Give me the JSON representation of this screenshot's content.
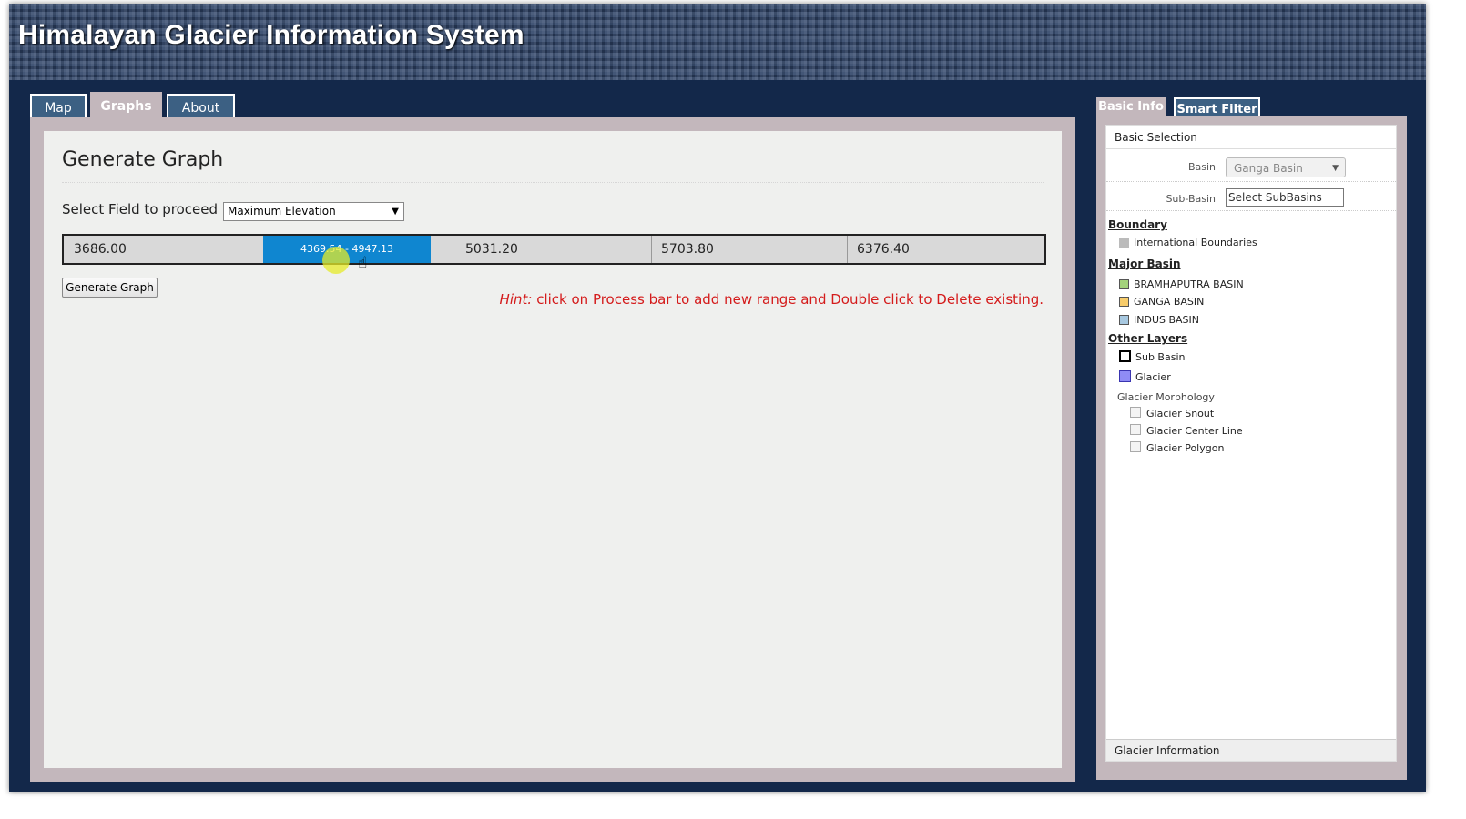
{
  "app": {
    "title": "Himalayan Glacier Information System"
  },
  "tabs": [
    {
      "label": "Map"
    },
    {
      "label": "Graphs"
    },
    {
      "label": "About"
    }
  ],
  "main": {
    "title": "Generate Graph",
    "field_label": "Select Field to proceed :",
    "field_select": {
      "selected": "Maximum Elevation"
    },
    "range_bar": {
      "segments": [
        "3686.00",
        "5031.20",
        "5703.80",
        "6376.40"
      ],
      "active_range": "4369.54 - 4947.13"
    },
    "generate_button": "Generate Graph",
    "hint_prefix": "Hint:",
    "hint_text": " click on Process bar to add new range and Double click to Delete existing."
  },
  "sidebar": {
    "tabs": [
      {
        "label": "Basic Info"
      },
      {
        "label": "Smart Filter"
      }
    ],
    "basic_selection": "Basic Selection",
    "basin_label": "Basin",
    "basin_value": "Ganga Basin",
    "subbasin_label": "Sub-Basin",
    "subbasin_value": "Select SubBasins",
    "boundary": {
      "heading": "Boundary",
      "items": [
        "International Boundaries"
      ]
    },
    "major_basin": {
      "heading": "Major Basin",
      "items": [
        {
          "label": "BRAMHAPUTRA BASIN",
          "color": "#a4d37c"
        },
        {
          "label": "GANGA BASIN",
          "color": "#f7cc6b"
        },
        {
          "label": "INDUS BASIN",
          "color": "#a7c8e0"
        }
      ]
    },
    "other_layers": {
      "heading": "Other Layers",
      "items": [
        {
          "label": "Sub Basin",
          "color": "#ffffff"
        },
        {
          "label": "Glacier",
          "color": "#8f8cf5"
        }
      ],
      "morphology": {
        "label": "Glacier Morphology",
        "items": [
          "Glacier Snout",
          "Glacier Center Line",
          "Glacier Polygon"
        ]
      }
    },
    "footer": "Glacier Information"
  },
  "colors": {
    "app_bg": "#13284a",
    "tab_blue": "#3c6083",
    "frame": "#c3b7bc",
    "range_active": "#0f86d0",
    "hint_red": "#d41b1b"
  },
  "icons": {
    "cursor": "hand-pointer-icon",
    "dropdown": "triangle-down-icon"
  }
}
